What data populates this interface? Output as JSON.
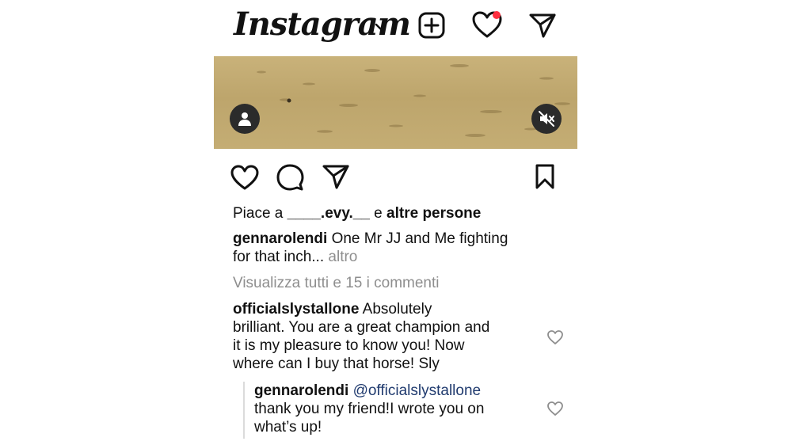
{
  "header": {
    "logo_text": "Instagram",
    "dropdown_icon": "chevron-down-icon",
    "actions": [
      "add-post-icon",
      "heart-icon",
      "direct-message-icon"
    ],
    "notification_dot_color": "#ff3040"
  },
  "post": {
    "media_buttons": [
      "user-tags-icon",
      "mute-icon"
    ],
    "actions": [
      "like-icon",
      "comment-icon",
      "share-icon",
      "save-icon"
    ],
    "likes": {
      "prefix": "Piace a ",
      "user": "____.evy.__",
      "middle": " e ",
      "suffix": "altre persone"
    },
    "caption": {
      "username": "gennarolendi",
      "text_line1": " One Mr JJ and Me fighting",
      "text_line2": "for that inch... ",
      "more": "altro"
    },
    "view_comments": "Visualizza tutti e 15 i commenti",
    "comments": [
      {
        "username": "officialslystallone",
        "line1": " Absolutely",
        "line2": "brilliant. You are a great champion and",
        "line3": "it is my pleasure to know you! Now",
        "line4": "where can I buy that horse! Sly"
      }
    ],
    "reply": {
      "username": "gennarolendi",
      "mention": " @officialslystallone",
      "line2": "thank you my friend!I wrote you on",
      "line3": "what’s up!"
    }
  }
}
